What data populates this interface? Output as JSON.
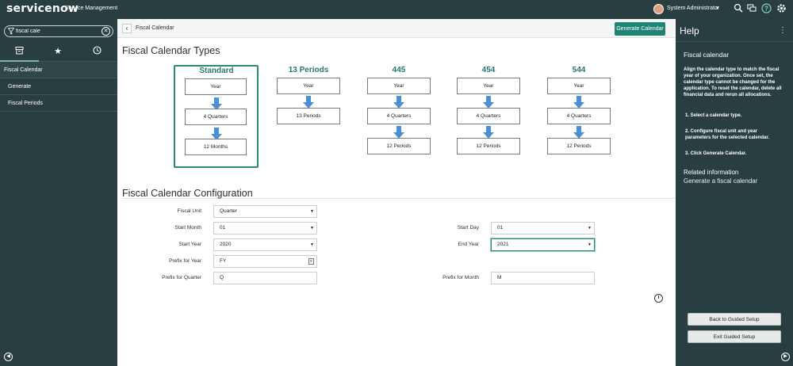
{
  "topbar": {
    "logo": "servicenow",
    "product": "Service Management",
    "user_name": "System Administrator",
    "icons": [
      "search-icon",
      "connect-icon",
      "help-icon",
      "settings-icon"
    ]
  },
  "nav": {
    "filter_value": "fiscal cale",
    "tab_icons": [
      "all-apps-icon",
      "favorites-icon",
      "history-icon"
    ],
    "items": [
      {
        "label": "Fiscal Calendar"
      },
      {
        "label": "Generate"
      },
      {
        "label": "Fiscal Periods"
      }
    ]
  },
  "main": {
    "title": "Fiscal Calendar",
    "generate_button": "Generate Calendar",
    "types_title": "Fiscal Calendar Types",
    "config_title": "Fiscal Calendar Configuration"
  },
  "types": [
    {
      "name": "Standard",
      "steps": [
        "Year",
        "4 Quarters",
        "12 Months"
      ],
      "selected": true
    },
    {
      "name": "13 Periods",
      "steps": [
        "Year",
        "13 Periods"
      ],
      "selected": false
    },
    {
      "name": "445",
      "steps": [
        "Year",
        "4 Quarters",
        "12 Periods"
      ],
      "selected": false
    },
    {
      "name": "454",
      "steps": [
        "Year",
        "4 Quarters",
        "12 Periods"
      ],
      "selected": false
    },
    {
      "name": "544",
      "steps": [
        "Year",
        "4 Quarters",
        "12 Periods"
      ],
      "selected": false
    }
  ],
  "form": {
    "fiscal_unit": {
      "label": "Fiscal Unit",
      "value": "Quarter"
    },
    "start_month": {
      "label": "Start Month",
      "value": "01"
    },
    "start_day": {
      "label": "Start Day",
      "value": "01"
    },
    "start_year": {
      "label": "Start Year",
      "value": "2020"
    },
    "end_year": {
      "label": "End Year",
      "value": "2021"
    },
    "prefix_year": {
      "label": "Prefix for Year",
      "value": "FY"
    },
    "prefix_quarter": {
      "label": "Prefix for Quarter",
      "value": "Q"
    },
    "prefix_month": {
      "label": "Prefix for Month",
      "value": "M"
    }
  },
  "help": {
    "title": "Help",
    "heading": "Fiscal calendar",
    "intro": "Align the calendar type to match the fiscal year of your organization. Once set, the calendar type cannot be changed for the application. To reset the calendar, delete all financial data and rerun all allocations.",
    "step1": "1. Select a calendar type.",
    "step2": "2. Configure fiscal unit and year parameters for the selected calendar.",
    "step3": "3. Click Generate Calendar.",
    "related_title": "Related information",
    "related_link": "Generate a fiscal calendar",
    "back_button": "Back to Guided Setup",
    "exit_button": "Exit Guided Setup"
  },
  "colors": {
    "chrome": "#293e40",
    "accent": "#1f8476",
    "arrow": "#4b8fd6"
  }
}
